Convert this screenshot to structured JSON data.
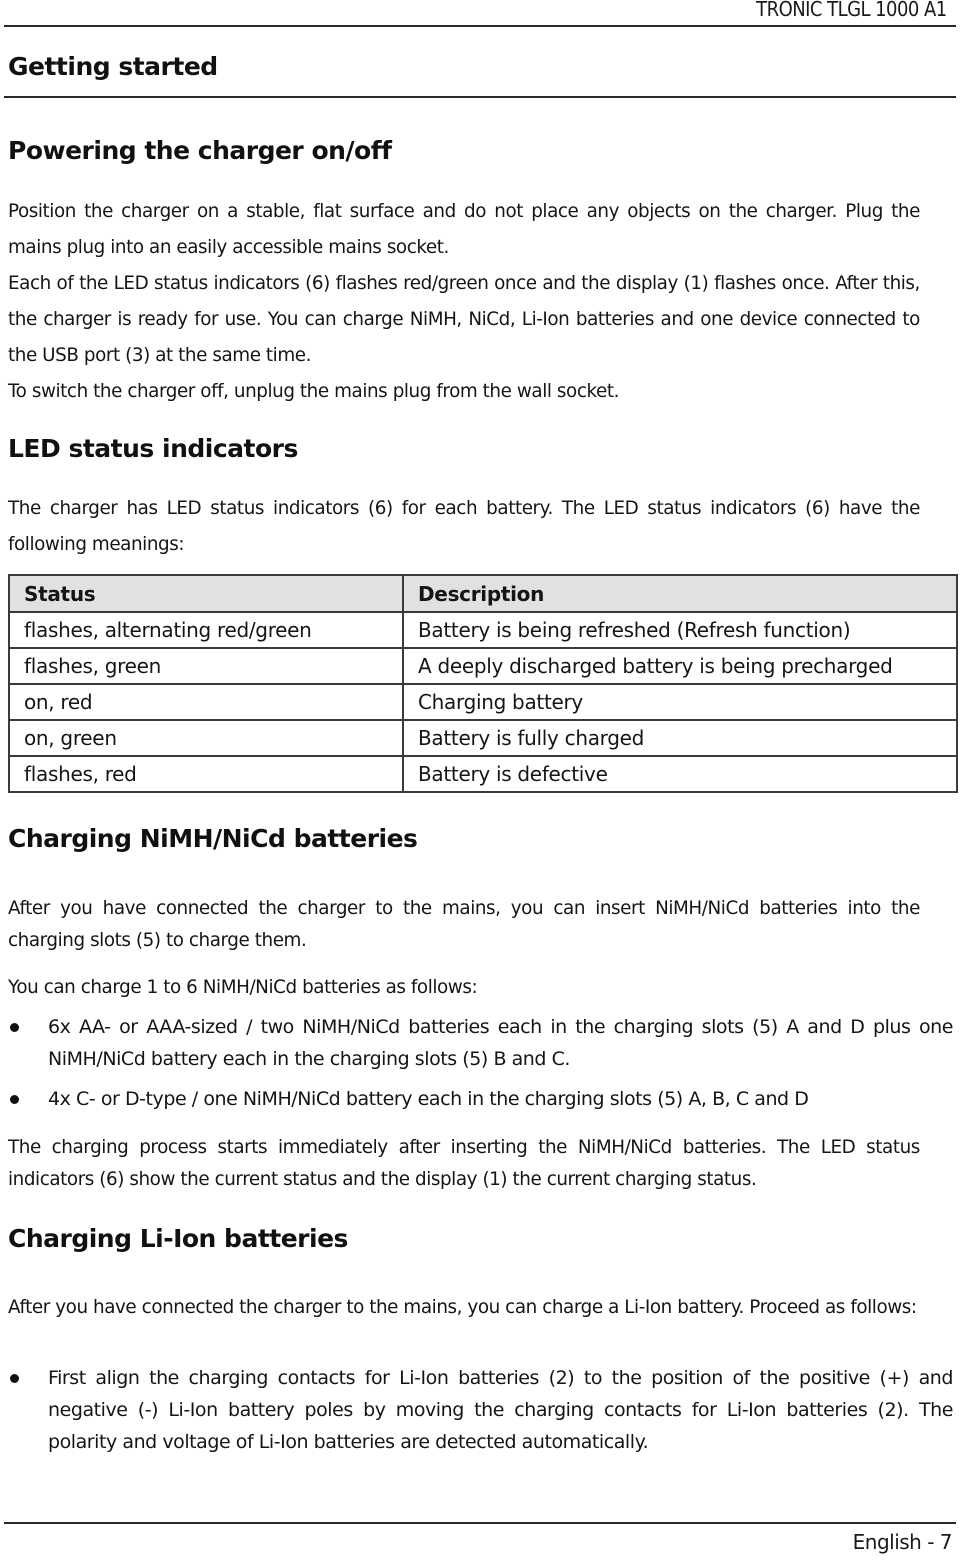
{
  "header": {
    "product": "TRONIC TLGL 1000 A1"
  },
  "page_title": "Getting started",
  "sections": {
    "power": {
      "heading": "Powering the charger on/off",
      "lines": [
        "Position the charger on a stable, flat surface and do not place any objects on the charger. Plug the mains plug into an easily accessible mains socket.",
        "Each of the LED status indicators (6) flashes red/green once and the display (1) flashes once. After this, the charger is ready for use. You can charge NiMH, NiCd, Li-Ion batteries and one device connected to the USB port (3) at the same time.",
        "To switch the charger off, unplug the mains plug from the wall socket."
      ]
    },
    "led": {
      "heading": "LED status indicators",
      "intro": "The charger has LED status indicators (6) for each battery. The LED status indicators (6) have the following meanings:",
      "table": {
        "headers": [
          "Status",
          "Description"
        ],
        "rows": [
          [
            "flashes, alternating red/green",
            "Battery is being refreshed (Refresh function)"
          ],
          [
            "flashes, green",
            "A deeply discharged battery is being precharged"
          ],
          [
            "on, red",
            "Charging battery"
          ],
          [
            "on, green",
            "Battery is fully charged"
          ],
          [
            "flashes, red",
            "Battery is defective"
          ]
        ]
      }
    },
    "nimh": {
      "heading": "Charging NiMH/NiCd batteries",
      "intro": "After you have connected the charger to the mains, you can insert NiMH/NiCd batteries into the charging slots (5) to charge them.",
      "lead": "You can charge 1 to 6 NiMH/NiCd batteries as follows:",
      "bullets": [
        "6x AA- or AAA-sized / two NiMH/NiCd batteries each in the charging slots (5) A and D plus one NiMH/NiCd battery each in the charging slots (5) B and C.",
        "4x C- or D-type / one NiMH/NiCd battery each in the charging slots (5) A, B, C and D"
      ],
      "outro": "The charging process starts immediately after inserting the NiMH/NiCd batteries. The LED status indicators (6) show the current status and the display (1) the current charging status."
    },
    "liion": {
      "heading": "Charging Li-Ion batteries",
      "intro": "After you have connected the charger to the mains, you can charge a Li-Ion battery. Proceed as follows:",
      "bullets": [
        "First align the charging contacts for Li-Ion batteries (2) to the position of the positive (+) and negative (-) Li-Ion battery poles by moving the charging contacts for Li-Ion batteries (2). The polarity and voltage of Li-Ion batteries are detected automatically."
      ]
    }
  },
  "footer": {
    "page_label": "English - 7"
  }
}
